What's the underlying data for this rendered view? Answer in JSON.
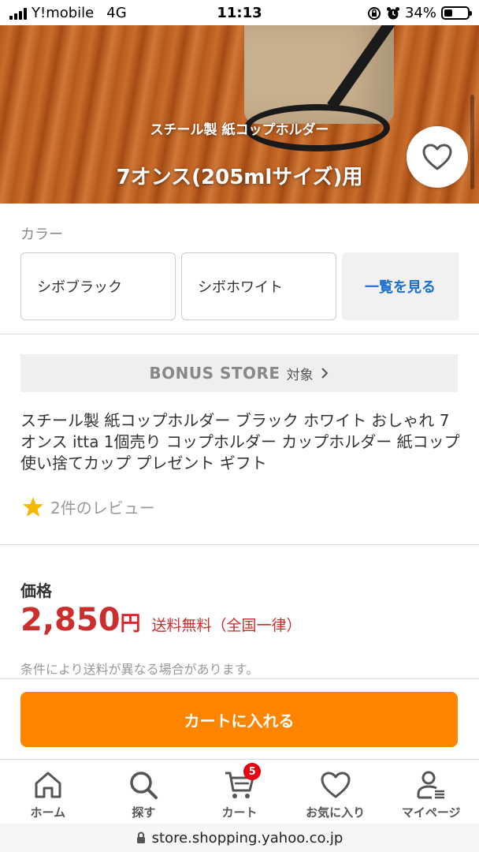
{
  "status_bar": {
    "carrier": "Y!mobile",
    "network": "4G",
    "time": "11:13",
    "battery_percent": "34%",
    "battery_level": 0.34
  },
  "hero": {
    "subtitle": "スチール製 紙コップホルダー",
    "title": "7オンス(205mlサイズ)用"
  },
  "color": {
    "label": "カラー",
    "options": [
      "シボブラック",
      "シボホワイト"
    ],
    "see_all": "一覧を見る"
  },
  "bonus": {
    "logo": "BONUS STORE",
    "target": "対象"
  },
  "product": {
    "title": "スチール製 紙コップホルダー ブラック ホワイト おしゃれ 7オンス itta 1個売り コップホルダー カップホルダー 紙コップ 使い捨てカップ プレゼント ギフト",
    "reviews": "2件のレビュー"
  },
  "price": {
    "label": "価格",
    "value": "2,850",
    "yen": "円",
    "shipping": "送料無料（全国一律）",
    "note": "条件により送料が異なる場合があります。"
  },
  "cart_button": "カートに入れる",
  "nav": {
    "items": [
      {
        "label": "ホーム",
        "icon": "home-icon"
      },
      {
        "label": "探す",
        "icon": "search-icon"
      },
      {
        "label": "カート",
        "icon": "cart-icon"
      },
      {
        "label": "お気に入り",
        "icon": "heart-icon"
      },
      {
        "label": "マイページ",
        "icon": "user-icon"
      }
    ],
    "cart_badge": "5"
  },
  "url": "store.shopping.yahoo.co.jp",
  "colors": {
    "price_red": "#cc2d2d",
    "cart_orange": "#ff8400",
    "link_blue": "#1a6fd4",
    "badge_red": "#e60012"
  }
}
